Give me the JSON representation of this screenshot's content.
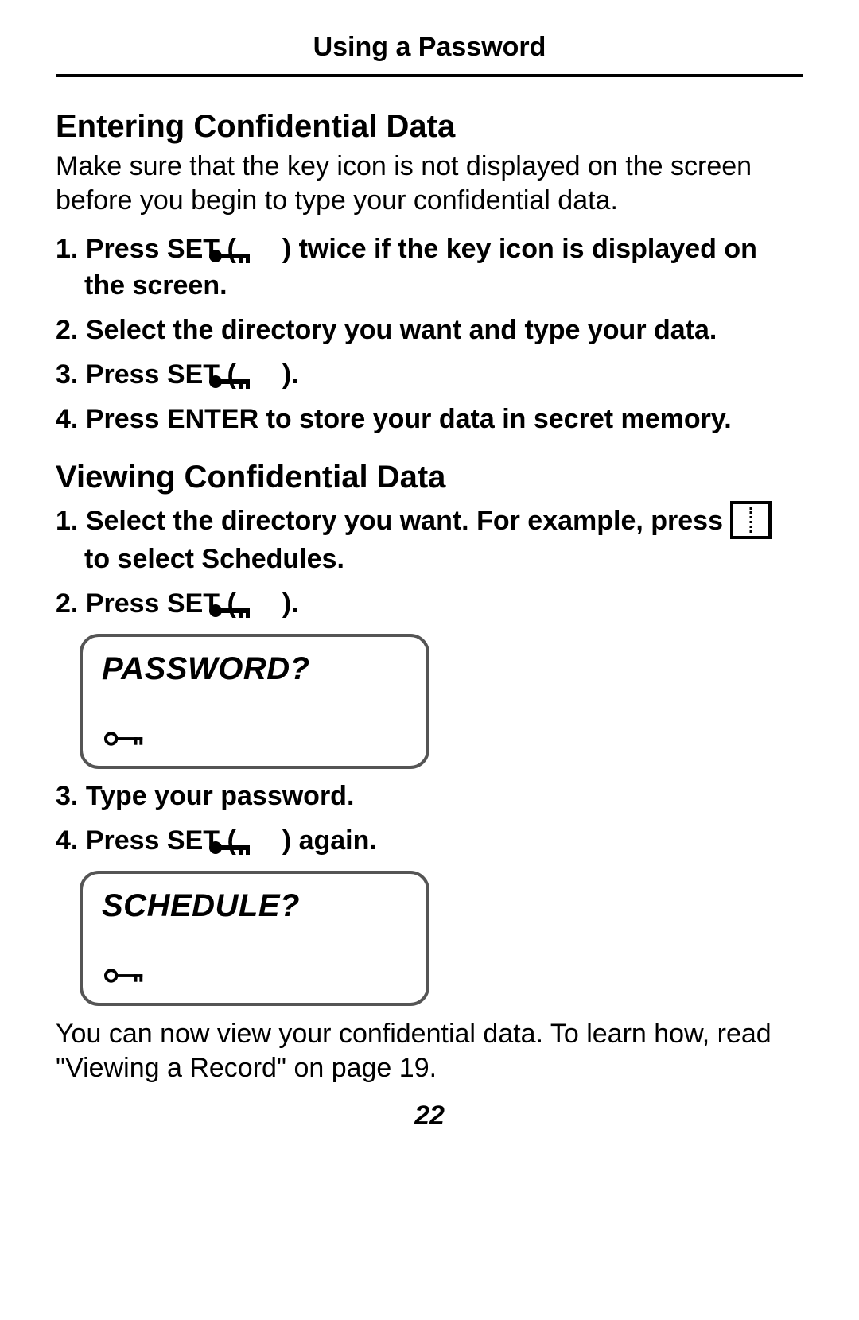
{
  "header": {
    "title": "Using a Password"
  },
  "section1": {
    "title": "Entering Confidential Data",
    "intro": "Make sure that the key icon is not displayed on the screen before you begin to type your confidential data.",
    "steps": {
      "s1a": "Press SET (",
      "s1b": ") twice if the key icon is displayed on the screen.",
      "s2": "Select the directory you want and type your data.",
      "s3a": "Press SET (",
      "s3b": ").",
      "s4": "Press ENTER to store your data in secret memory."
    }
  },
  "section2": {
    "title": "Viewing Confidential Data",
    "steps": {
      "s1a": "Select the directory you want. For example, press ",
      "s1b": " to select Schedules.",
      "s2a": "Press SET (",
      "s2b": ").",
      "s3": "Type your password.",
      "s4a": "Press SET (",
      "s4b": ") again."
    }
  },
  "lcd1": {
    "text": "PASSWORD?"
  },
  "lcd2": {
    "text": "SCHEDULE?"
  },
  "footer": "You can now view your confidential data. To learn how, read \"Viewing a Record\" on page 19.",
  "pageNumber": "22"
}
